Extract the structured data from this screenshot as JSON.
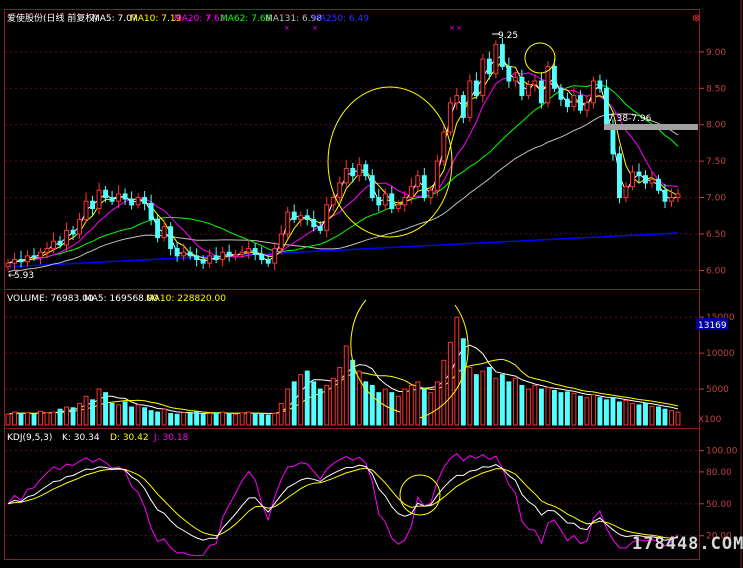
{
  "price_header": {
    "title": "爱使股份(日线 前复权)",
    "ma5": "MA5: 7.07",
    "ma10": "MA10: 7.19",
    "ma20": "MA20: 7.62",
    "ma62": "MA62: 7.68",
    "ma131": "MA131: 6.98",
    "ma250": "MA250: 6.49"
  },
  "volume_header": {
    "volume": "VOLUME: 76983.00",
    "ma5": "MA5: 169568.00",
    "ma10": "MA10: 228820.00"
  },
  "kdj_header": {
    "title": "KDJ(9,5,3)",
    "k": "K: 30.34",
    "d": "D: 30.42",
    "j": "J: 30.18"
  },
  "annotations": {
    "high_label": "9.25",
    "low_label": "5.93",
    "range_label": "7.38-7.96",
    "volume_badge": "13169",
    "volume_unit": "X100"
  },
  "watermark": "178448.COM",
  "colors": {
    "background": "#000000",
    "up_candle": "#ff3232",
    "down_candle": "#54ffff",
    "ma5": "#ffffff",
    "ma10": "#ffff00",
    "ma20": "#ff00ff",
    "ma62": "#00ff00",
    "ma131": "#c0c0c0",
    "ma250": "#0000ff",
    "axis_text": "#c04040",
    "annotation_circle": "#ffff00"
  },
  "chart_data": [
    {
      "type": "candlestick",
      "title": "爱使股份(日线 前复权)",
      "y_ticks": [
        "9.00",
        "8.50",
        "8.00",
        "7.50",
        "7.00",
        "6.50",
        "6.00"
      ],
      "ylim": [
        5.8,
        9.3
      ],
      "high": 9.25,
      "low": 5.93,
      "last_ma": {
        "MA5": 7.07,
        "MA10": 7.19,
        "MA20": 7.62,
        "MA62": 7.68,
        "MA131": 6.98,
        "MA250": 6.49
      },
      "closes": [
        6.1,
        6.15,
        6.12,
        6.2,
        6.18,
        6.25,
        6.3,
        6.4,
        6.35,
        6.55,
        6.5,
        6.7,
        6.95,
        6.85,
        7.1,
        7.0,
        6.95,
        7.05,
        6.98,
        6.9,
        7.0,
        6.92,
        6.7,
        6.45,
        6.6,
        6.3,
        6.2,
        6.25,
        6.2,
        6.15,
        6.1,
        6.2,
        6.15,
        6.25,
        6.2,
        6.22,
        6.25,
        6.3,
        6.22,
        6.15,
        6.1,
        6.3,
        6.5,
        6.8,
        6.7,
        6.75,
        6.7,
        6.6,
        6.55,
        6.9,
        7.0,
        7.2,
        7.4,
        7.3,
        7.45,
        7.3,
        7.0,
        6.9,
        7.05,
        6.85,
        6.9,
        7.0,
        7.15,
        7.3,
        7.0,
        7.1,
        7.5,
        7.9,
        8.3,
        8.4,
        8.1,
        8.6,
        8.4,
        8.9,
        8.7,
        9.1,
        8.8,
        8.6,
        8.65,
        8.4,
        8.55,
        8.6,
        8.3,
        8.8,
        8.5,
        8.35,
        8.25,
        8.4,
        8.2,
        8.3,
        8.6,
        8.5,
        8.0,
        7.6,
        7.0,
        7.15,
        7.35,
        7.3,
        7.2,
        7.25,
        7.1,
        6.95,
        7.0,
        7.05
      ]
    },
    {
      "type": "bar",
      "title": "VOLUME",
      "unit": "X100",
      "y_ticks": [
        "15000",
        "10000",
        "5000"
      ],
      "ylim": [
        0,
        16000
      ],
      "last": {
        "VOLUME": 76983.0,
        "MA5": 169568.0,
        "MA10": 228820.0
      },
      "values": [
        1500,
        1800,
        1600,
        1700,
        1500,
        1900,
        1700,
        1800,
        2200,
        2500,
        2400,
        3000,
        4000,
        3500,
        5000,
        4500,
        3000,
        2800,
        3200,
        2500,
        2800,
        2400,
        2000,
        1800,
        2200,
        1600,
        1500,
        1700,
        1600,
        1800,
        1500,
        1600,
        1700,
        1800,
        1600,
        1500,
        1700,
        1800,
        1600,
        1500,
        1400,
        1600,
        3000,
        5000,
        6000,
        7000,
        7500,
        6000,
        5000,
        5500,
        6500,
        8000,
        11000,
        9000,
        7500,
        6000,
        5500,
        4500,
        5000,
        4500,
        4000,
        5000,
        5500,
        6000,
        5000,
        4500,
        6000,
        9000,
        11500,
        15000,
        12000,
        8000,
        7000,
        7500,
        8000,
        6500,
        7000,
        6000,
        6500,
        5500,
        5000,
        5500,
        5000,
        5200,
        4800,
        4500,
        4600,
        4400,
        4000,
        3800,
        4200,
        3800,
        3500,
        3800,
        3200,
        3400,
        3000,
        2800,
        3000,
        2600,
        2500,
        2200,
        2000,
        1800
      ]
    },
    {
      "type": "line",
      "title": "KDJ(9,5,3)",
      "y_ticks": [
        "100.00",
        "80.00",
        "50.00",
        "20.00"
      ],
      "ylim": [
        0,
        110
      ],
      "last": {
        "K": 30.34,
        "D": 30.42,
        "J": 30.18
      }
    }
  ]
}
